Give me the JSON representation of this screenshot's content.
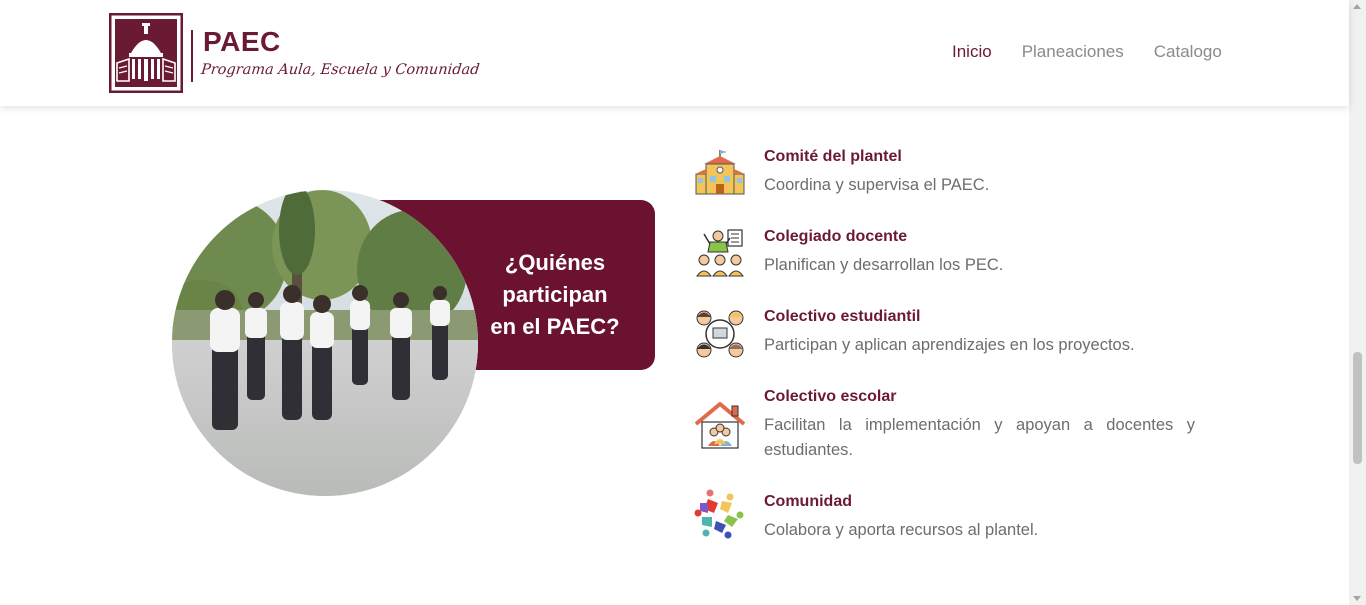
{
  "brand": {
    "title": "PAEC",
    "subtitle": "Programa Aula, Escuela y Comunidad"
  },
  "nav": {
    "items": [
      {
        "label": "Inicio",
        "active": true
      },
      {
        "label": "Planeaciones",
        "active": false
      },
      {
        "label": "Catalogo",
        "active": false
      }
    ]
  },
  "hero": {
    "heading_line1": "¿Quiénes",
    "heading_line2": "participan",
    "heading_line3": "en el PAEC?"
  },
  "participants": [
    {
      "icon": "school-building-icon",
      "title": "Comité del plantel",
      "description": "Coordina y supervisa el PAEC."
    },
    {
      "icon": "teachers-group-icon",
      "title": "Colegiado docente",
      "description": "Planifican y desarrollan los PEC."
    },
    {
      "icon": "student-collective-icon",
      "title": "Colectivo estudiantil",
      "description": "Participan y aplican aprendizajes en los proyectos."
    },
    {
      "icon": "school-house-icon",
      "title": "Colectivo escolar",
      "description": "Facilitan la implementación y apoyan a docentes y estudiantes."
    },
    {
      "icon": "community-circle-icon",
      "title": "Comunidad",
      "description": "Colabora y aporta recursos al plantel."
    }
  ],
  "colors": {
    "brand": "#6b1a33",
    "banner": "#6b1230",
    "text_muted": "#6d6d6d"
  }
}
